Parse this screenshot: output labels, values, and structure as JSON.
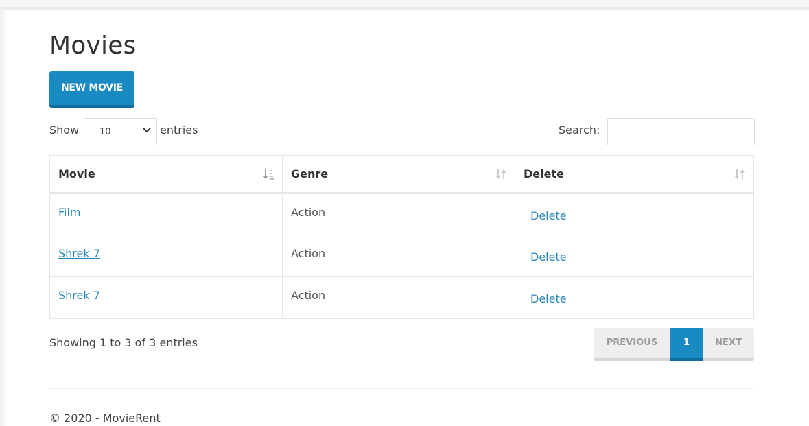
{
  "page": {
    "title": "Movies"
  },
  "actions": {
    "new_movie_label": "NEW MOVIE"
  },
  "length_control": {
    "show_label": "Show",
    "selected_value": "10",
    "entries_label": "entries"
  },
  "search": {
    "label": "Search:",
    "value": ""
  },
  "table": {
    "columns": [
      {
        "label": "Movie",
        "sort_state": "ascending"
      },
      {
        "label": "Genre",
        "sort_state": "unsorted"
      },
      {
        "label": "Delete",
        "sort_state": "unsorted"
      }
    ],
    "rows": [
      {
        "movie": "Film",
        "genre": "Action",
        "delete": "Delete"
      },
      {
        "movie": "Shrek 7",
        "genre": "Action",
        "delete": "Delete"
      },
      {
        "movie": "Shrek 7",
        "genre": "Action",
        "delete": "Delete"
      }
    ]
  },
  "info": "Showing 1 to 3 of 3 entries",
  "pagination": {
    "previous": "PREVIOUS",
    "current_page": "1",
    "next": "NEXT"
  },
  "footer": {
    "text": "© 2020 - MovieRent"
  },
  "colors": {
    "accent": "#1a8ac2",
    "link": "#2a88b8",
    "text": "#333333",
    "border": "#e6e6e6"
  }
}
